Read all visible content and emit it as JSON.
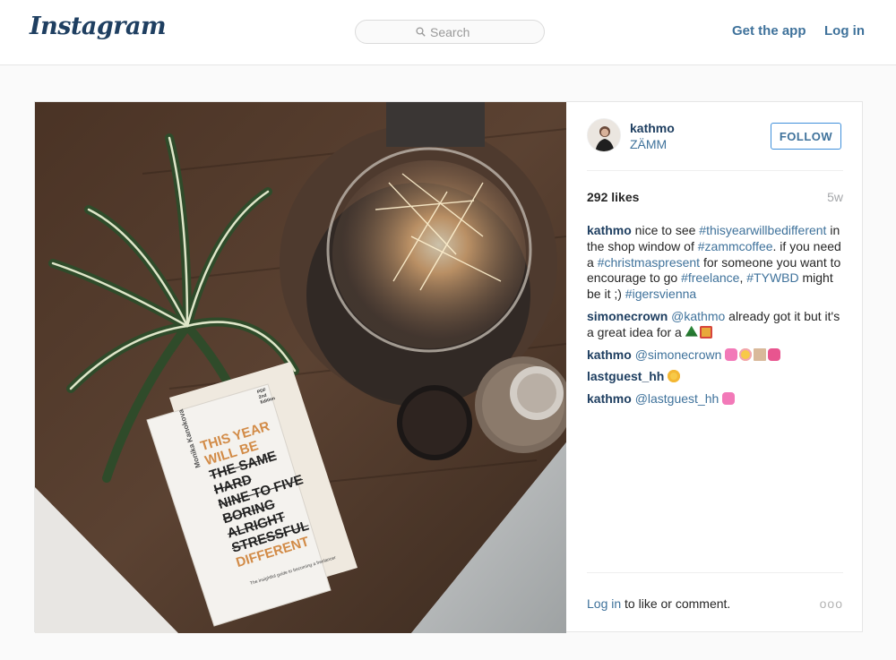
{
  "header": {
    "logo": "Instagram",
    "search_placeholder": "Search",
    "get_app": "Get the app",
    "login": "Log in"
  },
  "post": {
    "username": "kathmo",
    "location": "ZÄMM",
    "follow_label": "FOLLOW",
    "likes": "292 likes",
    "age": "5w",
    "comments": [
      {
        "user": "kathmo",
        "parts": [
          " nice to see ",
          "#thisyearwillbedifferent",
          " in the shop window of ",
          "#zammcoffee",
          ". if you need a ",
          "#christmaspresent",
          " for someone you want to encourage to go ",
          "#freelance",
          ", ",
          "#TYWBD",
          " might be it ;) ",
          "#igersvienna"
        ]
      },
      {
        "user": "simonecrown",
        "parts": [
          " ",
          "@kathmo",
          " already got it but it's a great idea for a "
        ],
        "emojis": [
          "tree-emoji",
          "gift-emoji"
        ]
      },
      {
        "user": "kathmo",
        "parts": [
          " ",
          "@simonecrown",
          " "
        ],
        "emojis": [
          "sparkling-heart-emoji",
          "princess-emoji",
          "tan-square-emoji",
          "cupid-heart-emoji"
        ]
      },
      {
        "user": "lastguest_hh",
        "parts": [
          " "
        ],
        "emojis": [
          "heart-eyes-emoji"
        ]
      },
      {
        "user": "kathmo",
        "parts": [
          " ",
          "@lastguest_hh",
          " "
        ],
        "emojis": [
          "sparkling-heart-emoji"
        ]
      }
    ],
    "footer_login": "Log in",
    "footer_text": " to like or comment.",
    "more_label": "ooo",
    "book": {
      "author": "Monika Kanokova",
      "title_lines": [
        "THIS YEAR",
        "WILL BE",
        "THE SAME",
        "HARD",
        "NINE TO FIVE",
        "BORING",
        "ALRIGHT",
        "STRESSFUL",
        "DIFFERENT"
      ],
      "subtitle": "The insightful guide to becoming a freelancer",
      "badge": "PDF 2nd Edition"
    }
  },
  "colors": {
    "link": "#3f729b",
    "username": "#1f3f61",
    "border": "#e6e6e6",
    "page_bg": "#fafafa"
  }
}
